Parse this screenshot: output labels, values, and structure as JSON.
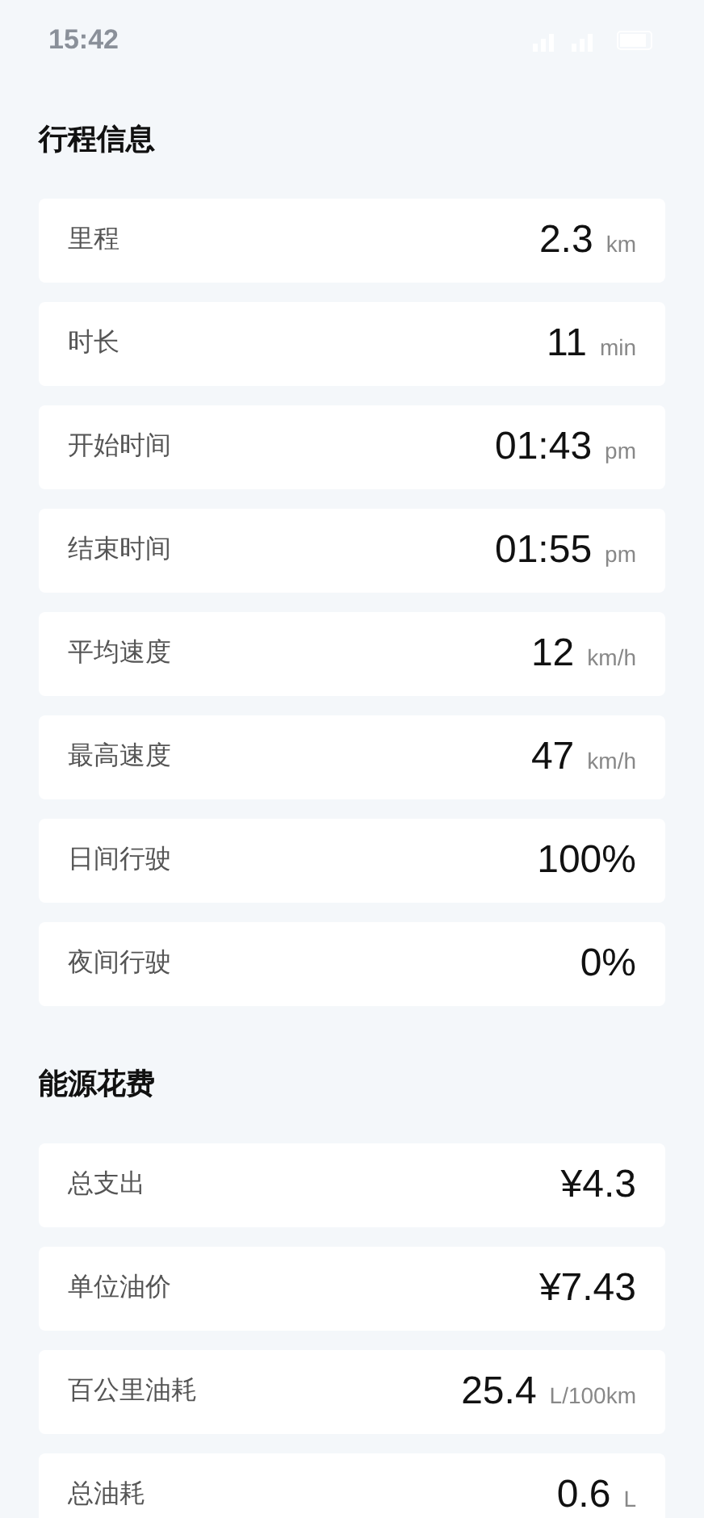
{
  "status_bar": {
    "time": "15:42"
  },
  "sections": [
    {
      "title": "行程信息",
      "rows": [
        {
          "label": "里程",
          "value": "2.3",
          "unit": "km"
        },
        {
          "label": "时长",
          "value": "11",
          "unit": "min"
        },
        {
          "label": "开始时间",
          "value": "01:43",
          "unit": "pm"
        },
        {
          "label": "结束时间",
          "value": "01:55",
          "unit": "pm"
        },
        {
          "label": "平均速度",
          "value": "12",
          "unit": "km/h"
        },
        {
          "label": "最高速度",
          "value": "47",
          "unit": "km/h"
        },
        {
          "label": "日间行驶",
          "value": "100%"
        },
        {
          "label": "夜间行驶",
          "value": "0%"
        }
      ]
    },
    {
      "title": "能源花费",
      "rows": [
        {
          "label": "总支出",
          "value": "¥4.3"
        },
        {
          "label": "单位油价",
          "value": "¥7.43"
        },
        {
          "label": "百公里油耗",
          "value": "25.4",
          "unit": "L/100km"
        },
        {
          "label": "总油耗",
          "value": "0.6",
          "unit": "L"
        }
      ]
    }
  ]
}
